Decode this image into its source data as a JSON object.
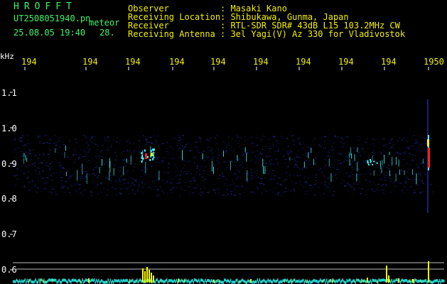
{
  "header": {
    "brand": "HROFFT",
    "filename": "UT2508051940.pn",
    "mode": "meteor",
    "datetime": "25.08.05 19:40",
    "count": "28.",
    "fields": [
      {
        "label": "Observer",
        "value": ": Masaki Kano"
      },
      {
        "label": "Receiving Location",
        "value": ": Shibukawa, Gunma, Japan"
      },
      {
        "label": "Receiver",
        "value": ": RTL-SDR SDR# 43dB L15 103.2MHz CW"
      },
      {
        "label": "Receiving Antenna",
        "value": ": 3el Yagi(V) Az 330 for Vladivostok"
      }
    ]
  },
  "axis": {
    "unit": "kHz",
    "y_ticks": [
      "1.1",
      "1.0",
      "0.9",
      "0.8",
      "0.7",
      "0.6"
    ],
    "time_ticks": [
      "194",
      "194",
      "194",
      "194",
      "194",
      "194",
      "194",
      "194",
      "194",
      "1950"
    ]
  },
  "colors": {
    "text_green": "#3df56a",
    "text_yellow": "#f2f000",
    "text_white": "#ffffff",
    "noise_blue": "#1a2a90",
    "echo_cyan": "#40ffff",
    "echo_red": "#ff2020",
    "bar_yellow": "#ffff00",
    "baseline_cyan": "#20d0d0"
  }
}
